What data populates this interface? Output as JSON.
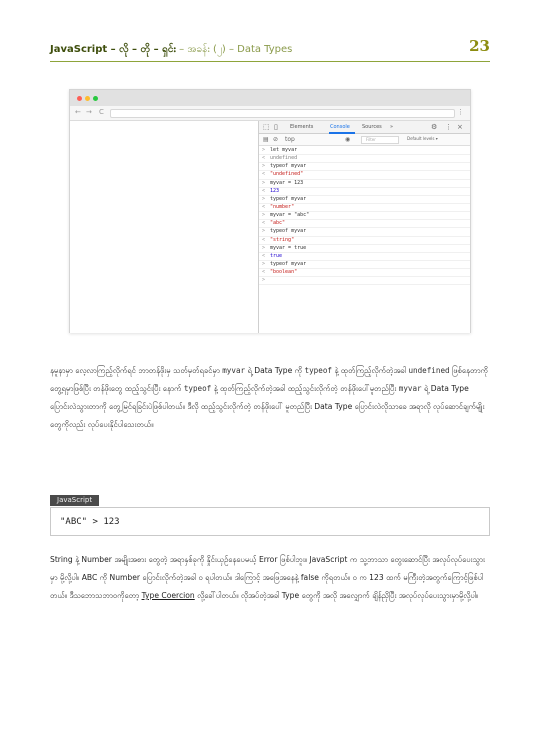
{
  "header": {
    "title": "JavaScript – လို – တို – ရှင်း",
    "subtitle": " – အခန်း (၂) – Data Types",
    "page_number": "23"
  },
  "browser": {
    "nav_back": "←",
    "nav_forward": "→",
    "nav_reload": "C",
    "menu": "⋮"
  },
  "devtools": {
    "tabs": [
      "Elements",
      "Console",
      "Sources",
      "»"
    ],
    "toolbar": {
      "context": "top",
      "filter_placeholder": "Filter",
      "levels": "Default levels ▾"
    },
    "console_lines": [
      {
        "prefix": ">",
        "text": "let myvar",
        "kind": "in"
      },
      {
        "prefix": "<",
        "text": "undefined",
        "kind": "und"
      },
      {
        "prefix": ">",
        "text": "typeof myvar",
        "kind": "in"
      },
      {
        "prefix": "<",
        "text": "\"undefined\"",
        "kind": "out"
      },
      {
        "prefix": ">",
        "text": "myvar = 123",
        "kind": "in"
      },
      {
        "prefix": "<",
        "text": "123",
        "kind": "num"
      },
      {
        "prefix": ">",
        "text": "typeof myvar",
        "kind": "in"
      },
      {
        "prefix": "<",
        "text": "\"number\"",
        "kind": "out"
      },
      {
        "prefix": ">",
        "text": "myvar = \"abc\"",
        "kind": "in"
      },
      {
        "prefix": "<",
        "text": "\"abc\"",
        "kind": "out"
      },
      {
        "prefix": ">",
        "text": "typeof myvar",
        "kind": "in"
      },
      {
        "prefix": "<",
        "text": "\"string\"",
        "kind": "out"
      },
      {
        "prefix": ">",
        "text": "myvar = true",
        "kind": "in"
      },
      {
        "prefix": "<",
        "text": "true",
        "kind": "num"
      },
      {
        "prefix": ">",
        "text": "typeof myvar",
        "kind": "in"
      },
      {
        "prefix": "<",
        "text": "\"boolean\"",
        "kind": "out"
      },
      {
        "prefix": ">",
        "text": "",
        "kind": "in"
      }
    ]
  },
  "paragraph1": {
    "a": "နမူနာမှာ လေ့လာကြည့်လိုက်ရင် ဘာတန်ဖိုးမှ သတ်မှတ်ရခင်မှာ ",
    "b": "myvar",
    "c": " ရဲ့ Data Type ကို ",
    "d": "typeof",
    "e": " နဲ့ ထုတ်ကြည့်လိုက်တဲ့အခါ ",
    "f": "undefined",
    "g": " ဖြစ်နေတာကိုတွေ့ရမှာဖြစ်ပြီး တန်ဖိုးတွေ ထည့်သွင်းပြီး နောက် ",
    "h": "typeof",
    "i": " နဲ့ ထုတ်ကြည့်လိုက်တဲ့အခါ ထည့်သွင်းလိုက်တဲ့ တန်ဖိုးပေါ်မူတည်ပြီး ",
    "j": "myvar",
    "k": " ရဲ့ Data Type ပြောင်းလဲသွားတာကို တွေ့မြင်ရခြင်းပဲဖြစ်ပါတယ်။ ဒီလို ထည့်သွင်းလိုက်တဲ့ တန်ဖိုးပေါ် မူတည်ပြီး Data Type ပြောင်းလဲလိုသာခေ အရာလို လုပ်ဆောင်ချက်မျိုးတွေကိုလည်း လုပ်ပေးနိုင်ပါသေးတယ်။"
  },
  "code_example": {
    "label": "JavaScript",
    "code": "\"ABC\" > 123"
  },
  "paragraph2": {
    "a": "String နဲ့ Number အမျိုးအစား တွေတဲ့ အရာနှစ်ခုကို နှိုင်းယှဉ်နေပေမယ့် Error ဖြစ်ပါဘူး။ JavaScript က သူ့ဘာသာ တွေးဆောင်ပြီး အလုပ်လုပ်ပေးသွားမှာ မို့လို့ပါ။ ABC ကို Number ပြောင်းလိုက်တဲ့အခါ ၀ ရပါတယ်။ ဒါကြောင့် အဖြေအနေနဲ့ false ကိုရတယ်။ ၀ က 123 ထက် မကြီးတဲ့အတွက်ကြောင့်ဖြစ်ပါ တယ်။ ဒီသဘောသဘာဝကိုတော့ ",
    "b": "Type Coercion",
    "c": " လို့ခေါ်ပါတယ်။ လိုအပ်တဲ့အခါ Type တွေကို အလို အလျှောက် ချိန်ညှိပြီး အလုပ်လုပ်ပေးသွားမှာမို့လို့ပါ။"
  }
}
